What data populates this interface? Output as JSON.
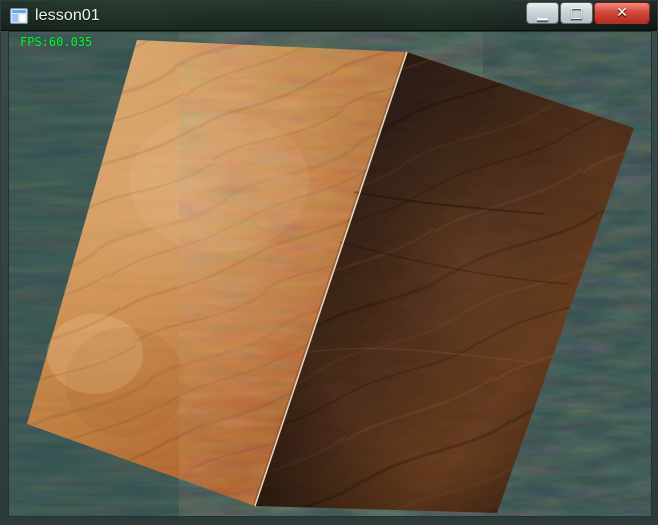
{
  "window": {
    "title": "lesson01",
    "icon": "app-window-icon"
  },
  "titlebar": {
    "buttons": {
      "minimize": {
        "label": "",
        "icon": "minimize-icon"
      },
      "maximize": {
        "label": "",
        "icon": "maximize-icon"
      },
      "close": {
        "label": "",
        "icon": "close-icon"
      }
    }
  },
  "viewport": {
    "fps_text": "FPS:60.035",
    "colors": {
      "background": "#2f4f4f",
      "fps": "#00ff2a"
    }
  }
}
